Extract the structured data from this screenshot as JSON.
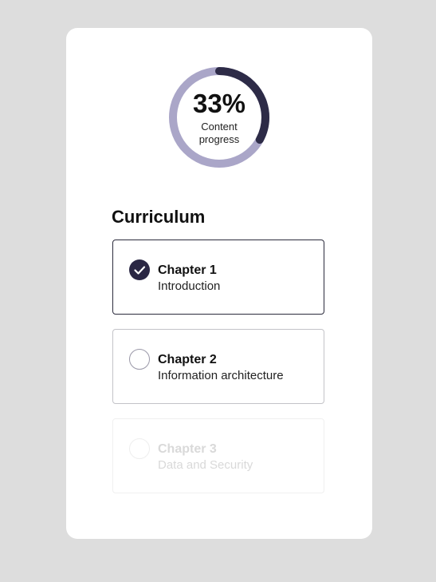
{
  "progress": {
    "percent_text": "33%",
    "value": 0.33,
    "label": "Content progress",
    "track_color": "#aaa6c8",
    "fill_color": "#2d2b47"
  },
  "curriculum": {
    "title": "Curriculum",
    "chapters": [
      {
        "title": "Chapter 1",
        "subtitle": "Introduction",
        "status": "completed",
        "status_icon": "check-icon"
      },
      {
        "title": "Chapter 2",
        "subtitle": "Information architecture",
        "status": "available",
        "status_icon": "empty-circle-icon"
      },
      {
        "title": "Chapter 3",
        "subtitle": "Data and Security",
        "status": "locked",
        "status_icon": "empty-circle-icon"
      }
    ]
  }
}
